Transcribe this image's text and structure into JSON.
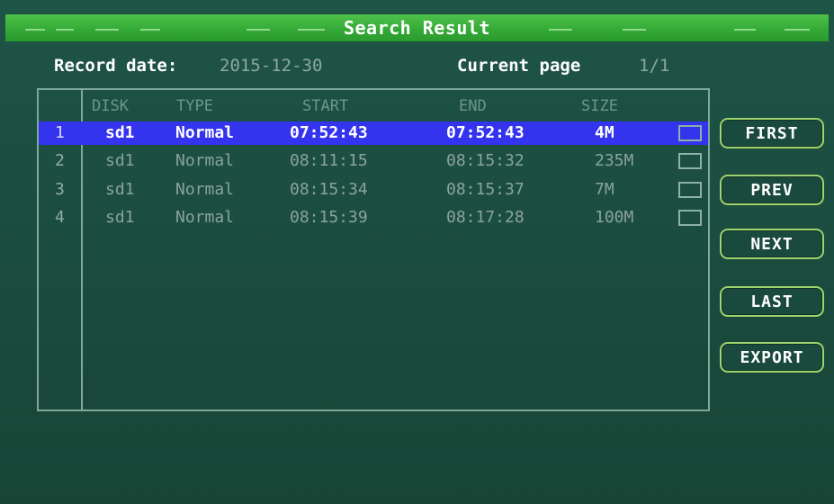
{
  "title": "Search Result",
  "header": {
    "record_date_label": "Record date:",
    "record_date_value": "2015-12-30",
    "current_page_label": "Current page",
    "current_page_value": "1/1"
  },
  "table": {
    "columns": [
      "DISK",
      "TYPE",
      "START",
      "END",
      "SIZE"
    ],
    "rows": [
      {
        "index": "1",
        "disk": "sd1",
        "type": "Normal",
        "start": "07:52:43",
        "end": "07:52:43",
        "size": "4M",
        "selected": true
      },
      {
        "index": "2",
        "disk": "sd1",
        "type": "Normal",
        "start": "08:11:15",
        "end": "08:15:32",
        "size": "235M",
        "selected": false
      },
      {
        "index": "3",
        "disk": "sd1",
        "type": "Normal",
        "start": "08:15:34",
        "end": "08:15:37",
        "size": "7M",
        "selected": false
      },
      {
        "index": "4",
        "disk": "sd1",
        "type": "Normal",
        "start": "08:15:39",
        "end": "08:17:28",
        "size": "100M",
        "selected": false
      }
    ]
  },
  "buttons": {
    "first": "FIRST",
    "prev": "PREV",
    "next": "NEXT",
    "last": "LAST",
    "export": "EXPORT"
  },
  "colors": {
    "background": "#1b4d40",
    "titlebar": "#33a835",
    "selected_row": "#3434ee",
    "button_border": "#9fd36e"
  }
}
